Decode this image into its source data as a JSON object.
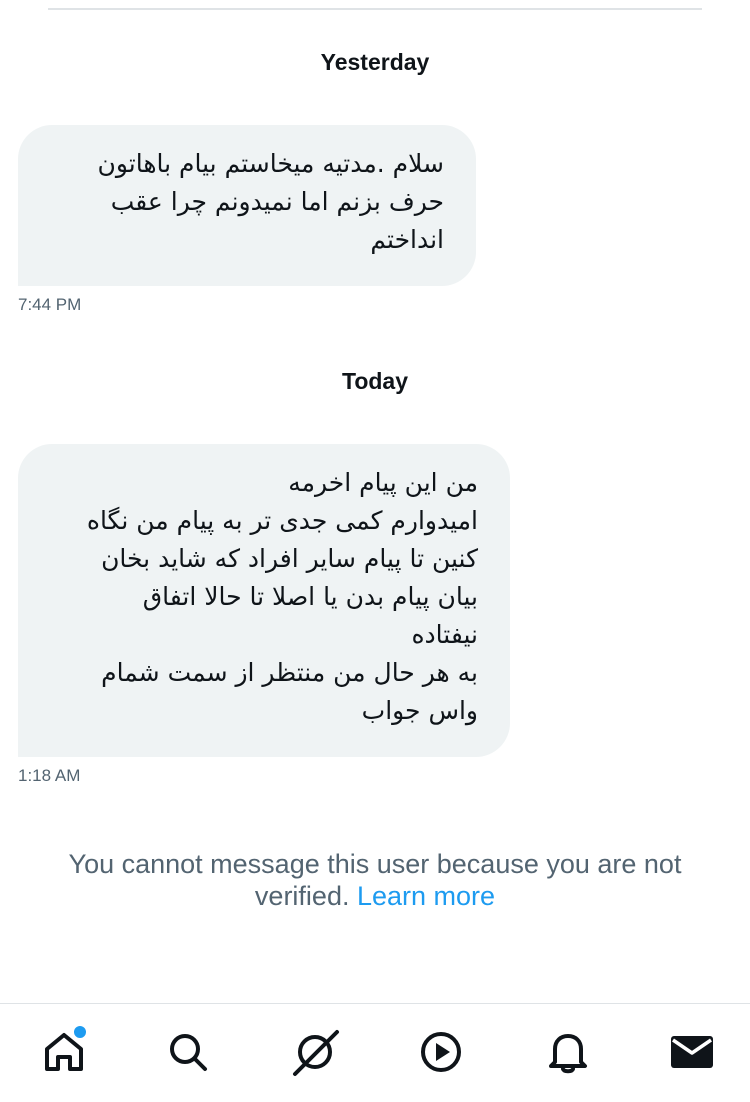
{
  "conversation": {
    "groups": [
      {
        "date_label": "Yesterday",
        "message": {
          "lines": [
            "سلام .مدتیه میخاستم بیام باهاتون",
            "حرف بزنم اما نمیدونم چرا عقب",
            "انداختم"
          ],
          "time": "7:44 PM"
        }
      },
      {
        "date_label": "Today",
        "message": {
          "lines": [
            "من این پیام اخرمه",
            "امیدوارم کمی جدی تر به پیام من نگاه",
            "کنین تا پیام سایر افراد که شاید بخان",
            "بیان پیام بدن یا اصلا تا حالا اتفاق",
            "نیفتاده",
            "به هر حال من منتظر از سمت شمام",
            "واس جواب"
          ],
          "time": "1:18 AM"
        }
      }
    ]
  },
  "notice": {
    "text": "You cannot message this user because you are not verified.",
    "link": "Learn more"
  },
  "tabbar": {
    "tabs": [
      {
        "icon": "home-icon",
        "active": true,
        "has_unread_dot": true
      },
      {
        "icon": "search-icon"
      },
      {
        "icon": "grok-icon"
      },
      {
        "icon": "video-icon"
      },
      {
        "icon": "notifications-icon"
      },
      {
        "icon": "messages-icon",
        "active": true
      }
    ]
  },
  "colors": {
    "text": "#0f1419",
    "muted": "#536471",
    "bubble": "#eff3f4",
    "accent": "#1d9bf0",
    "divider": "#dfe3e6"
  }
}
